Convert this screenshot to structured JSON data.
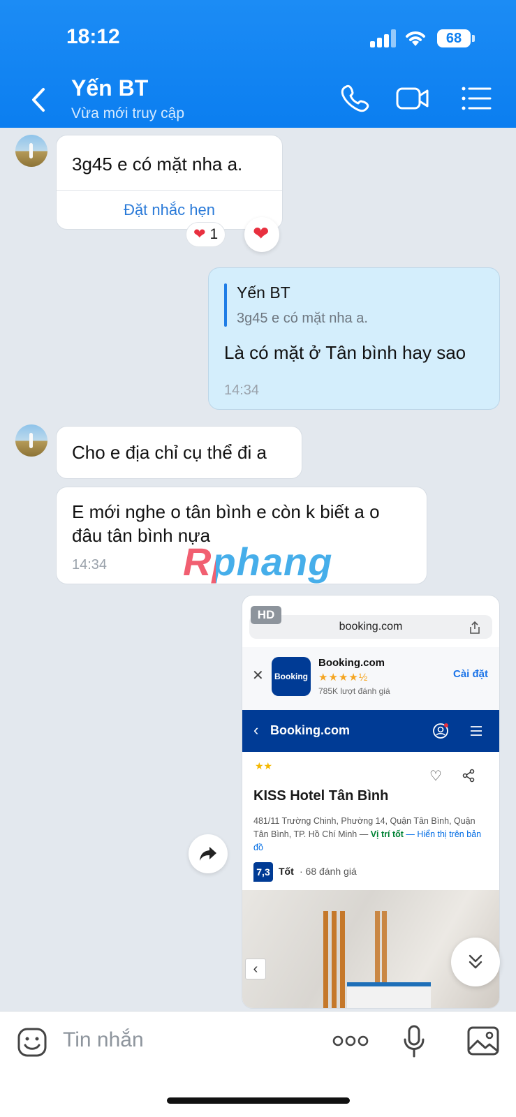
{
  "status_bar": {
    "time": "18:12",
    "battery": "68"
  },
  "header": {
    "contact_name": "Yến BT",
    "contact_status": "Vừa mới truy cập",
    "icons": [
      "back-icon",
      "phone-icon",
      "video-icon",
      "menu-icon"
    ]
  },
  "messages": [
    {
      "sender": "them",
      "text": "3g45 e có mặt nha a.",
      "action": "Đặt nhắc hẹn",
      "reaction": "❤",
      "reaction_count": "1"
    },
    {
      "sender": "me",
      "quote_name": "Yến BT",
      "quote_text": "3g45 e có mặt nha a.",
      "text": "Là có mặt ở Tân bình hay sao",
      "time": "14:34"
    },
    {
      "sender": "them",
      "text": "Cho e địa chỉ cụ thể đi a"
    },
    {
      "sender": "them",
      "text_line1": "E mới nghe o tân bình e còn k biết a o",
      "text_line2": "đâu tân bình nựa",
      "time": "14:34"
    }
  ],
  "image_card": {
    "hd_label": "HD",
    "url": "booking.com",
    "app_name": "Booking.com",
    "app_logo_text": "Booking",
    "app_rating_stars": "★★★★½",
    "app_reviews": "785K lượt đánh giá",
    "install_label": "Cài đặt",
    "nav_title": "Booking.com",
    "hotel_stars": "★★",
    "hotel_name": "KISS Hotel Tân Bình",
    "address": "481/11 Trường Chinh, Phường 14, Quận Tân Bình, Quận Tân Bình, TP. Hồ Chí Minh —",
    "location_good": "Vị trí tốt",
    "map_link_line1": "— Hiển thị trên",
    "map_link_line2": "bản đồ",
    "score": "7,3",
    "score_label": "Tốt",
    "review_count": "· 68 đánh giá"
  },
  "watermark": "Rphang",
  "composer": {
    "placeholder": "Tin nhắn"
  },
  "colors": {
    "header": "#0b7ef0",
    "background": "#e3e8ee",
    "my_bubble": "#d4eefc",
    "booking_blue": "#003b95",
    "heart": "#e8303f"
  }
}
